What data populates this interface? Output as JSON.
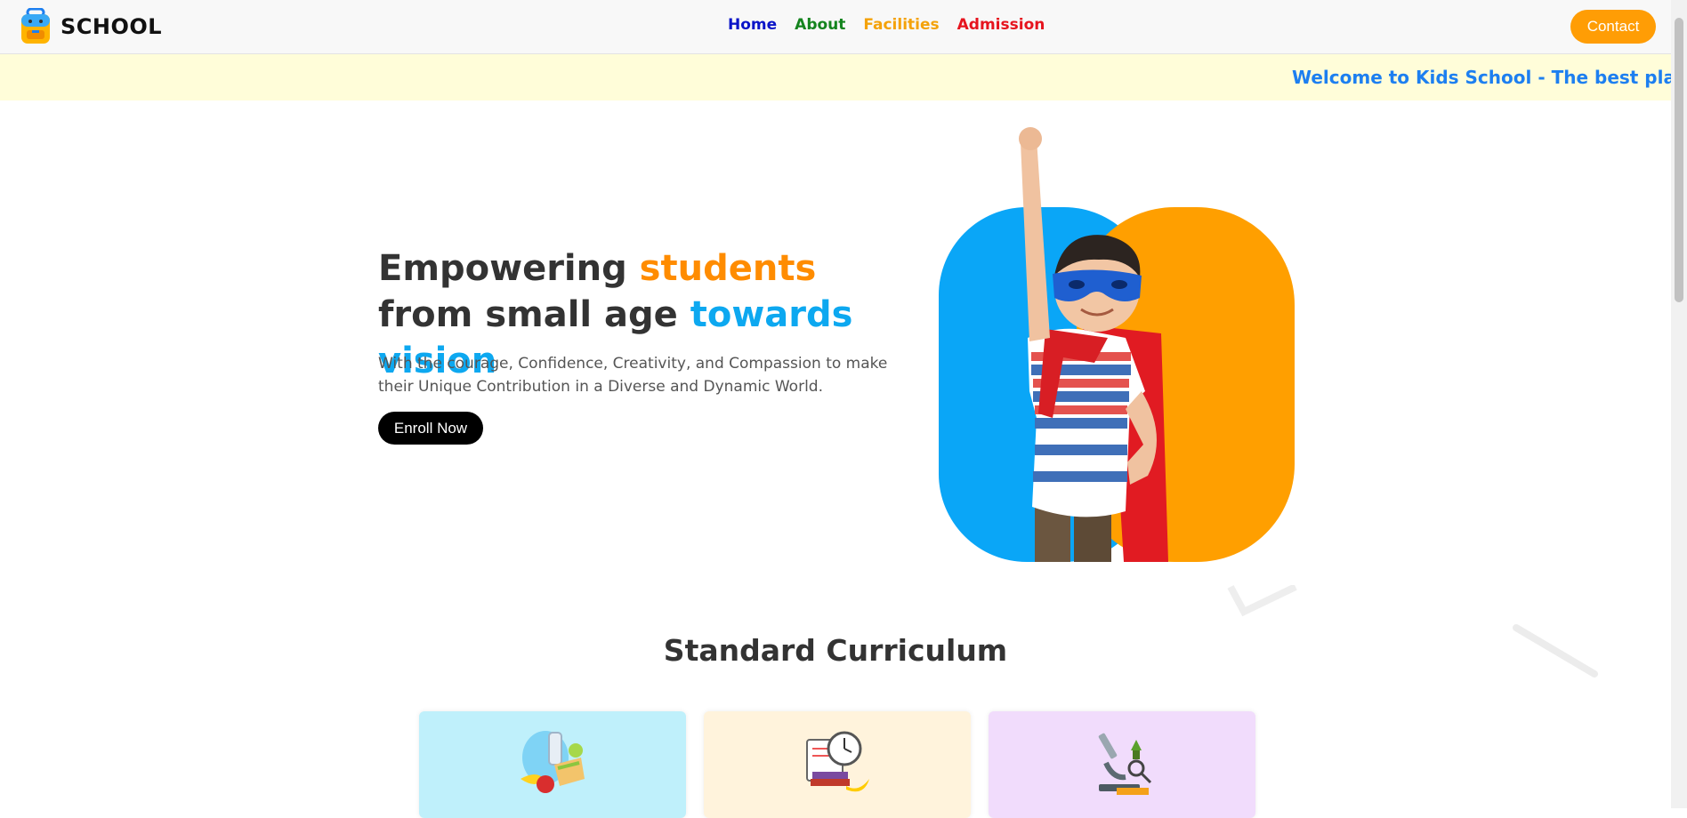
{
  "header": {
    "brand": "SCHOOL",
    "nav": [
      {
        "label": "Home",
        "color": "#0a14c8"
      },
      {
        "label": "About",
        "color": "#14841e"
      },
      {
        "label": "Facilities",
        "color": "#f4a20a"
      },
      {
        "label": "Admission",
        "color": "#e6141e"
      }
    ],
    "contact_label": "Contact"
  },
  "ticker": {
    "text": "Welcome to Kids School - The best place to e"
  },
  "hero": {
    "title_part1": "Empowering ",
    "title_accent1": "students",
    "title_part2": " from small age ",
    "title_accent2": "towards vision",
    "subtitle": "With the courage, Confidence, Creativity, and Compassion to make their Unique Contribution in a Diverse and Dynamic World.",
    "cta_label": "Enroll Now"
  },
  "curriculum": {
    "title": "Standard Curriculum",
    "cards": [
      {
        "icon": "lunch-icon",
        "bg": "#bff0fb"
      },
      {
        "icon": "study-clock-icon",
        "bg": "#fff3dc"
      },
      {
        "icon": "microscope-icon",
        "bg": "#f1dcfc"
      }
    ]
  },
  "colors": {
    "accent_orange": "#ff9d05",
    "accent_blue": "#0da8f0",
    "ticker_bg": "#fffdd9"
  }
}
